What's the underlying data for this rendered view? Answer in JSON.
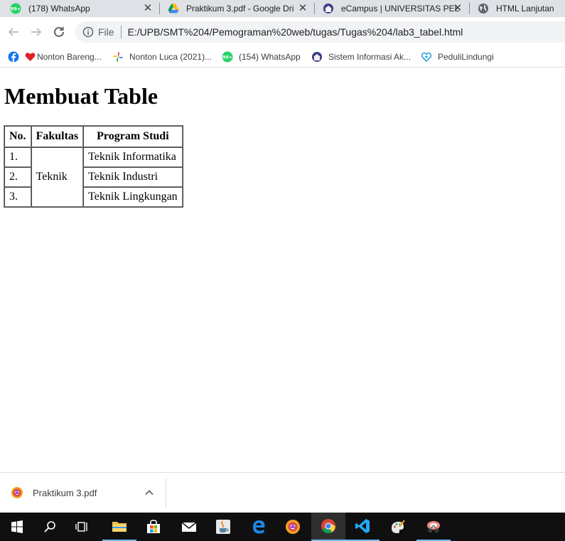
{
  "browser": {
    "tabs": [
      {
        "title": "(178) WhatsApp",
        "icon": "whatsapp-icon",
        "badge": "99+"
      },
      {
        "title": "Praktikum 3.pdf - Google Dri",
        "icon": "google-drive-icon"
      },
      {
        "title": "eCampus | UNIVERSITAS PEL",
        "icon": "university-icon"
      },
      {
        "title": "HTML Lanjutan",
        "icon": "globe-icon"
      }
    ],
    "omnibox": {
      "scheme_label": "File",
      "url": "E:/UPB/SMT%204/Pemograman%20web/tugas/Tugas%204/lab3_tabel.html"
    },
    "bookmarks": [
      {
        "label": "",
        "icon": "facebook-icon"
      },
      {
        "label": "Nonton Bareng...",
        "icon": "heart-icon"
      },
      {
        "label": "Nonton Luca (2021)...",
        "icon": "pinwheel-icon"
      },
      {
        "label": "(154) WhatsApp",
        "icon": "whatsapp-icon",
        "badge": "99+"
      },
      {
        "label": "Sistem Informasi Ak...",
        "icon": "university-icon"
      },
      {
        "label": "PeduliLindungi",
        "icon": "pedulilindungi-icon"
      }
    ]
  },
  "page": {
    "heading": "Membuat Table",
    "table": {
      "headers": [
        "No.",
        "Fakultas",
        "Program Studi"
      ],
      "rows": [
        {
          "no": "1.",
          "program": "Teknik Informatika"
        },
        {
          "no": "2.",
          "program": "Teknik Industri"
        },
        {
          "no": "3.",
          "program": "Teknik Lingkungan"
        }
      ],
      "fakultas": "Teknik"
    }
  },
  "download_shelf": {
    "items": [
      {
        "filename": "Praktikum 3.pdf",
        "icon": "pdf-reader-icon"
      }
    ]
  },
  "taskbar": {
    "items": [
      {
        "name": "start",
        "icon": "windows-icon"
      },
      {
        "name": "search",
        "icon": "search-icon"
      },
      {
        "name": "task-view",
        "icon": "task-view-icon"
      },
      {
        "name": "file-explorer",
        "icon": "folder-icon"
      },
      {
        "name": "microsoft-store",
        "icon": "store-icon"
      },
      {
        "name": "mail",
        "icon": "mail-icon"
      },
      {
        "name": "java",
        "icon": "java-icon"
      },
      {
        "name": "edge",
        "icon": "edge-icon"
      },
      {
        "name": "avast",
        "icon": "avast-icon"
      },
      {
        "name": "chrome",
        "icon": "chrome-icon",
        "active": true
      },
      {
        "name": "vscode",
        "icon": "vscode-icon"
      },
      {
        "name": "paint",
        "icon": "paint-icon"
      },
      {
        "name": "snipping-tool",
        "icon": "snip-icon"
      }
    ],
    "colors": {
      "background": "#101010",
      "accent": "#76b9ed"
    }
  },
  "colors": {
    "tabstrip": "#dee1e6",
    "omnibox": "#f1f3f4",
    "whatsapp": "#25d366",
    "facebook": "#1877f2"
  }
}
